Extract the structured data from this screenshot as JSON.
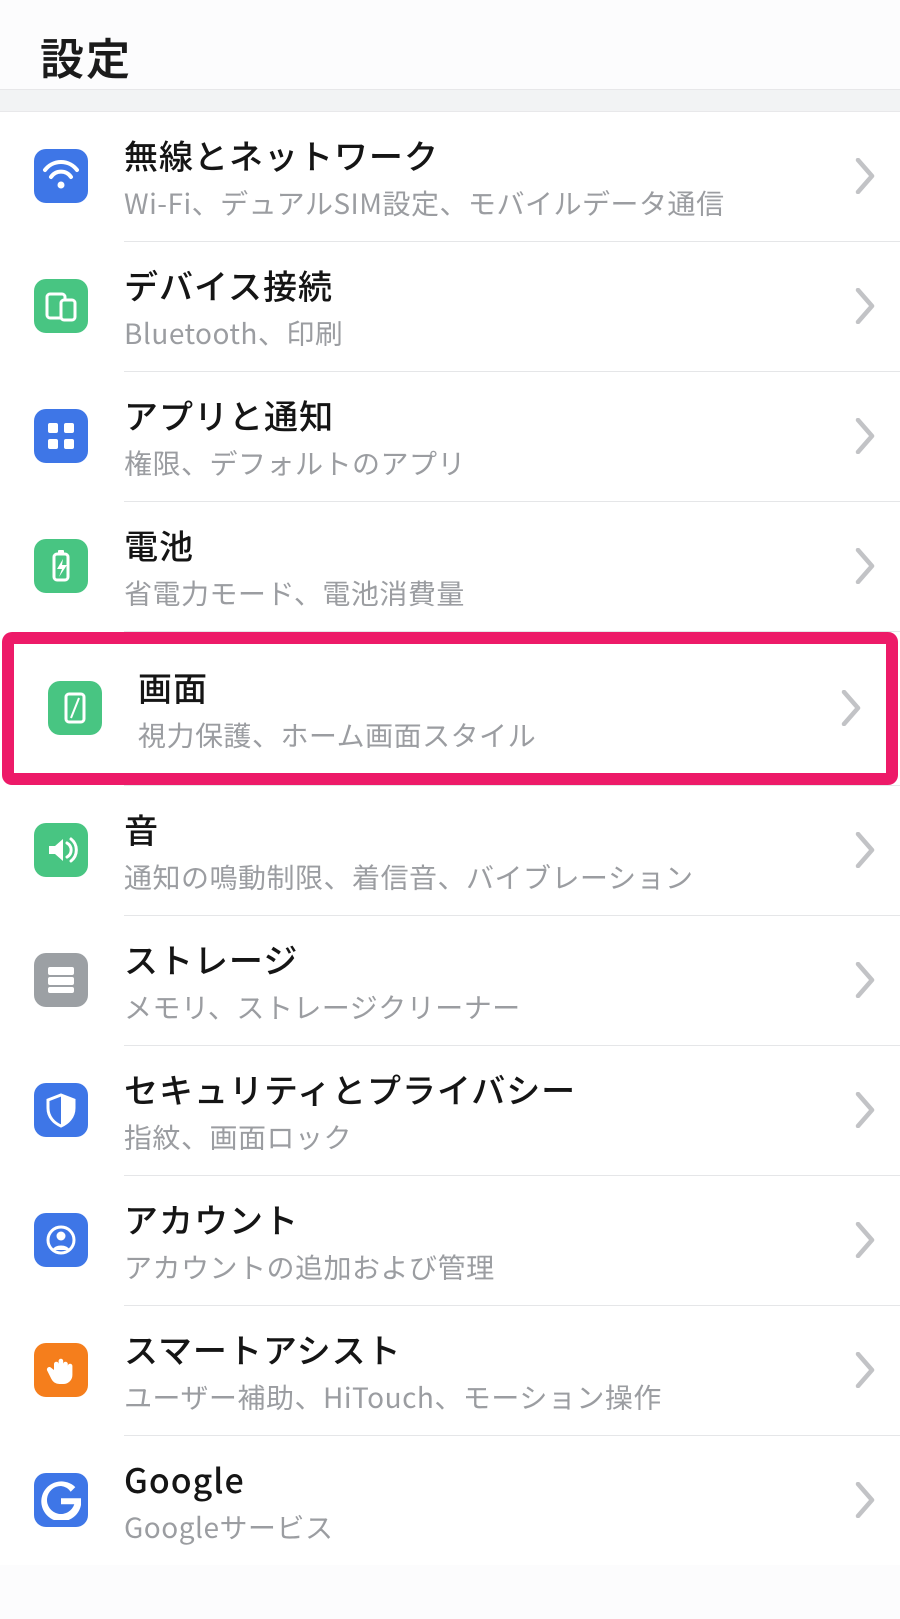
{
  "header": {
    "title": "設定"
  },
  "colors": {
    "blue": "#3e76e7",
    "green": "#48c582",
    "gray": "#9ca0a4",
    "orange": "#f57e1c",
    "gblue": "#3e76e7",
    "highlight": "#ed1a68"
  },
  "items": [
    {
      "key": "wireless",
      "icon": "wifi-icon",
      "color": "blue",
      "title": "無線とネットワーク",
      "subtitle": "Wi-Fi、デュアルSIM設定、モバイルデータ通信"
    },
    {
      "key": "devices",
      "icon": "devices-icon",
      "color": "green",
      "title": "デバイス接続",
      "subtitle": "Bluetooth、印刷"
    },
    {
      "key": "apps",
      "icon": "apps-icon",
      "color": "blue",
      "title": "アプリと通知",
      "subtitle": "権限、デフォルトのアプリ"
    },
    {
      "key": "battery",
      "icon": "battery-icon",
      "color": "green",
      "title": "電池",
      "subtitle": "省電力モード、電池消費量"
    },
    {
      "key": "display",
      "icon": "display-icon",
      "color": "green",
      "title": "画面",
      "subtitle": "視力保護、ホーム画面スタイル",
      "highlighted": true
    },
    {
      "key": "sound",
      "icon": "sound-icon",
      "color": "green",
      "title": "音",
      "subtitle": "通知の鳴動制限、着信音、バイブレーション"
    },
    {
      "key": "storage",
      "icon": "storage-icon",
      "color": "gray",
      "title": "ストレージ",
      "subtitle": "メモリ、ストレージクリーナー"
    },
    {
      "key": "security",
      "icon": "shield-icon",
      "color": "blue",
      "title": "セキュリティとプライバシー",
      "subtitle": "指紋、画面ロック"
    },
    {
      "key": "accounts",
      "icon": "user-icon",
      "color": "blue",
      "title": "アカウント",
      "subtitle": "アカウントの追加および管理"
    },
    {
      "key": "smart",
      "icon": "hand-icon",
      "color": "orange",
      "title": "スマートアシスト",
      "subtitle": "ユーザー補助、HiTouch、モーション操作"
    },
    {
      "key": "google",
      "icon": "google-icon",
      "color": "gblue",
      "title": "Google",
      "subtitle": "Googleサービス"
    }
  ]
}
